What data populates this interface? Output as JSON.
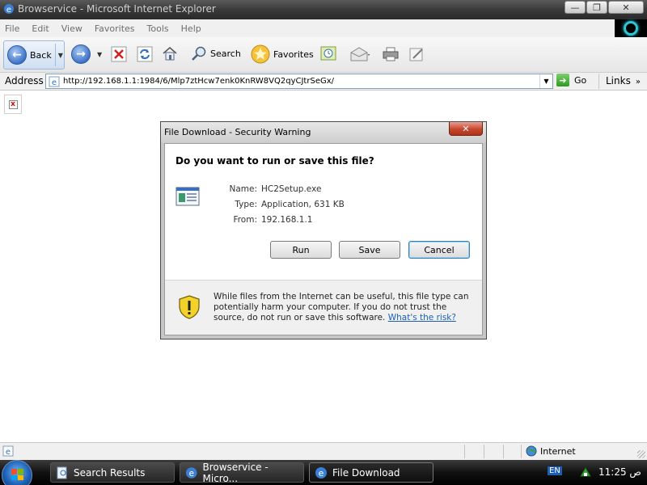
{
  "window": {
    "title": "Browservice - Microsoft Internet Explorer",
    "caption_buttons": {
      "minimize": "—",
      "restore": "❐",
      "close": "✕"
    }
  },
  "menu": [
    "File",
    "Edit",
    "View",
    "Favorites",
    "Tools",
    "Help"
  ],
  "toolbar": {
    "back_label": "Back",
    "search_label": "Search",
    "favorites_label": "Favorites"
  },
  "address_bar": {
    "label": "Address",
    "url": "http://192.168.1.1:1984/6/Mlp7ztHcw7enk0KnRW8VQ2qyCJtrSeGx/",
    "go_label": "Go",
    "links_label": "Links"
  },
  "dialog": {
    "title": "File Download - Security Warning",
    "close_glyph": "✕",
    "question": "Do you want to run or save this file?",
    "name_label": "Name:",
    "name_value": "HC2Setup.exe",
    "type_label": "Type:",
    "type_value": "Application, 631 KB",
    "from_label": "From:",
    "from_value": "192.168.1.1",
    "run_label": "Run",
    "save_label": "Save",
    "cancel_label": "Cancel",
    "warning_text": "While files from the Internet can be useful, this file type can potentially harm your computer. If you do not trust the source, do not run or save this software.",
    "risk_link": "What's the risk?"
  },
  "status_bar": {
    "zone": "Internet"
  },
  "taskbar": {
    "tasks": [
      {
        "label": "Search Results"
      },
      {
        "label": "Browservice - Micro..."
      },
      {
        "label": "File Download"
      }
    ],
    "language": "EN",
    "clock": "11:25 ص"
  },
  "colors": {
    "link": "#1e5fb3",
    "title_bar": "#3a3a3a",
    "close_button": "#c7462e",
    "taskbar": "#111111"
  },
  "icons": [
    "ie-icon",
    "back-arrow-icon",
    "forward-arrow-icon",
    "stop-icon",
    "refresh-icon",
    "home-icon",
    "search-icon",
    "favorites-star-icon",
    "history-icon",
    "mail-icon",
    "print-icon",
    "edit-icon",
    "go-arrow-icon",
    "broken-image-icon",
    "file-exe-icon",
    "shield-warning-icon",
    "globe-icon",
    "windows-flag-icon"
  ]
}
